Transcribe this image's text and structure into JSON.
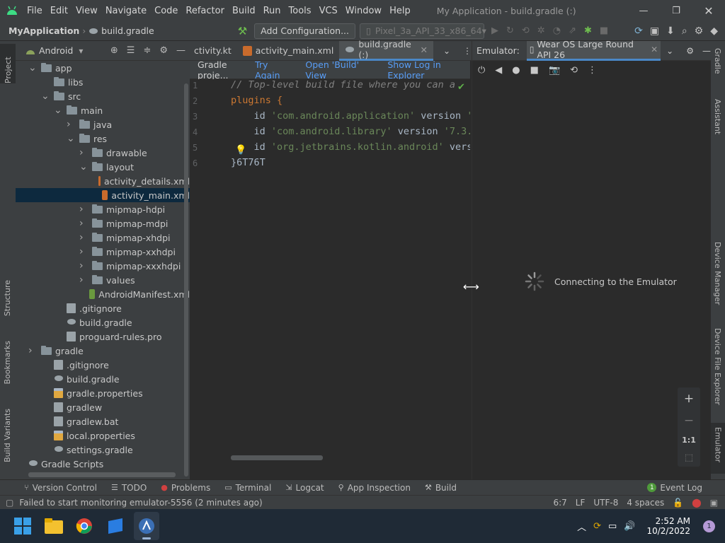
{
  "menubar": {
    "items": [
      "File",
      "Edit",
      "View",
      "Navigate",
      "Code",
      "Refactor",
      "Build",
      "Run",
      "Tools",
      "VCS",
      "Window",
      "Help"
    ],
    "title": "My Application - build.gradle (:)"
  },
  "toolbar": {
    "project": "MyApplication",
    "file": "build.gradle",
    "config": "Add Configuration...",
    "device": "Pixel_3a_API_33_x86_64"
  },
  "left_strip": [
    "Project",
    "Structure",
    "Bookmarks",
    "Build Variants"
  ],
  "right_strip": [
    "Gradle",
    "Assistant",
    "Device Manager",
    "Device File Explorer",
    "Emulator"
  ],
  "project_panel": {
    "view": "Android",
    "tree": [
      {
        "label": "app",
        "depth": 0,
        "arrow": "down",
        "icon": "folder"
      },
      {
        "label": "libs",
        "depth": 1,
        "arrow": "",
        "icon": "folder"
      },
      {
        "label": "src",
        "depth": 1,
        "arrow": "down",
        "icon": "folder"
      },
      {
        "label": "main",
        "depth": 2,
        "arrow": "down",
        "icon": "folder"
      },
      {
        "label": "java",
        "depth": 3,
        "arrow": "right",
        "icon": "folder"
      },
      {
        "label": "res",
        "depth": 3,
        "arrow": "down",
        "icon": "folder"
      },
      {
        "label": "drawable",
        "depth": 4,
        "arrow": "right",
        "icon": "folder"
      },
      {
        "label": "layout",
        "depth": 4,
        "arrow": "down",
        "icon": "folder"
      },
      {
        "label": "activity_details.xml",
        "depth": 5,
        "arrow": "",
        "icon": "xml"
      },
      {
        "label": "activity_main.xml",
        "depth": 5,
        "arrow": "",
        "icon": "xml",
        "selected": true
      },
      {
        "label": "mipmap-hdpi",
        "depth": 4,
        "arrow": "right",
        "icon": "folder"
      },
      {
        "label": "mipmap-mdpi",
        "depth": 4,
        "arrow": "right",
        "icon": "folder"
      },
      {
        "label": "mipmap-xhdpi",
        "depth": 4,
        "arrow": "right",
        "icon": "folder"
      },
      {
        "label": "mipmap-xxhdpi",
        "depth": 4,
        "arrow": "right",
        "icon": "folder"
      },
      {
        "label": "mipmap-xxxhdpi",
        "depth": 4,
        "arrow": "right",
        "icon": "folder"
      },
      {
        "label": "values",
        "depth": 4,
        "arrow": "right",
        "icon": "folder"
      },
      {
        "label": "AndroidManifest.xml",
        "depth": 4,
        "arrow": "",
        "icon": "manifest"
      },
      {
        "label": ".gitignore",
        "depth": 2,
        "arrow": "",
        "icon": "file"
      },
      {
        "label": "build.gradle",
        "depth": 2,
        "arrow": "",
        "icon": "gradle"
      },
      {
        "label": "proguard-rules.pro",
        "depth": 2,
        "arrow": "",
        "icon": "file"
      },
      {
        "label": "gradle",
        "depth": 0,
        "arrow": "right",
        "icon": "folder"
      },
      {
        "label": ".gitignore",
        "depth": 1,
        "arrow": "",
        "icon": "file"
      },
      {
        "label": "build.gradle",
        "depth": 1,
        "arrow": "",
        "icon": "gradle"
      },
      {
        "label": "gradle.properties",
        "depth": 1,
        "arrow": "",
        "icon": "props"
      },
      {
        "label": "gradlew",
        "depth": 1,
        "arrow": "",
        "icon": "file"
      },
      {
        "label": "gradlew.bat",
        "depth": 1,
        "arrow": "",
        "icon": "file"
      },
      {
        "label": "local.properties",
        "depth": 1,
        "arrow": "",
        "icon": "props"
      },
      {
        "label": "settings.gradle",
        "depth": 1,
        "arrow": "",
        "icon": "gradle"
      },
      {
        "label": "Gradle Scripts",
        "depth": -1,
        "arrow": "",
        "icon": "gradle"
      }
    ]
  },
  "tabs": [
    {
      "label": "ctivity.kt",
      "active": false
    },
    {
      "label": "activity_main.xml",
      "active": false
    },
    {
      "label": "build.gradle (:)",
      "active": true
    }
  ],
  "notice": {
    "text": "Gradle proje...",
    "links": [
      "Try Again",
      "Open 'Build' View",
      "Show Log in Explorer"
    ]
  },
  "editor": {
    "line_numbers": [
      "1",
      "2",
      "3",
      "4",
      "5",
      "6"
    ],
    "lines": [
      [
        {
          "t": "// Top-level build file where you can a",
          "c": "#808080",
          "i": true
        }
      ],
      [
        {
          "t": "plugins {",
          "c": "#cc7832"
        }
      ],
      [
        {
          "t": "    id ",
          "c": "#a9b7c6"
        },
        {
          "t": "'com.android.application'",
          "c": "#6a8759"
        },
        {
          "t": " version ",
          "c": "#a9b7c6"
        },
        {
          "t": "'",
          "c": "#6a8759"
        }
      ],
      [
        {
          "t": "    id ",
          "c": "#a9b7c6"
        },
        {
          "t": "'com.android.library'",
          "c": "#6a8759"
        },
        {
          "t": " version ",
          "c": "#a9b7c6"
        },
        {
          "t": "'7.3.",
          "c": "#6a8759"
        }
      ],
      [
        {
          "t": "    id ",
          "c": "#a9b7c6"
        },
        {
          "t": "'org.jetbrains.kotlin.android'",
          "c": "#6a8759"
        },
        {
          "t": " versi",
          "c": "#a9b7c6"
        }
      ],
      [
        {
          "t": "}",
          "c": "#a9b7c6"
        },
        {
          "t": "6T76T",
          "c": "#a9b7c6"
        }
      ]
    ]
  },
  "emulator": {
    "label": "Emulator:",
    "device_tab": "Wear OS Large Round API 26",
    "connecting": "Connecting to the Emulator",
    "zoom_ratio": "1:1"
  },
  "tool_windows": [
    "Version Control",
    "TODO",
    "Problems",
    "Terminal",
    "Logcat",
    "App Inspection",
    "Build"
  ],
  "event_log": {
    "count": "1",
    "label": "Event Log"
  },
  "status": {
    "message": "Failed to start monitoring emulator-5556 (2 minutes ago)",
    "position": "6:7",
    "line_sep": "LF",
    "encoding": "UTF-8",
    "indent": "4 spaces"
  },
  "taskbar": {
    "time": "2:52 AM",
    "date": "10/2/2022",
    "badge": "1"
  }
}
